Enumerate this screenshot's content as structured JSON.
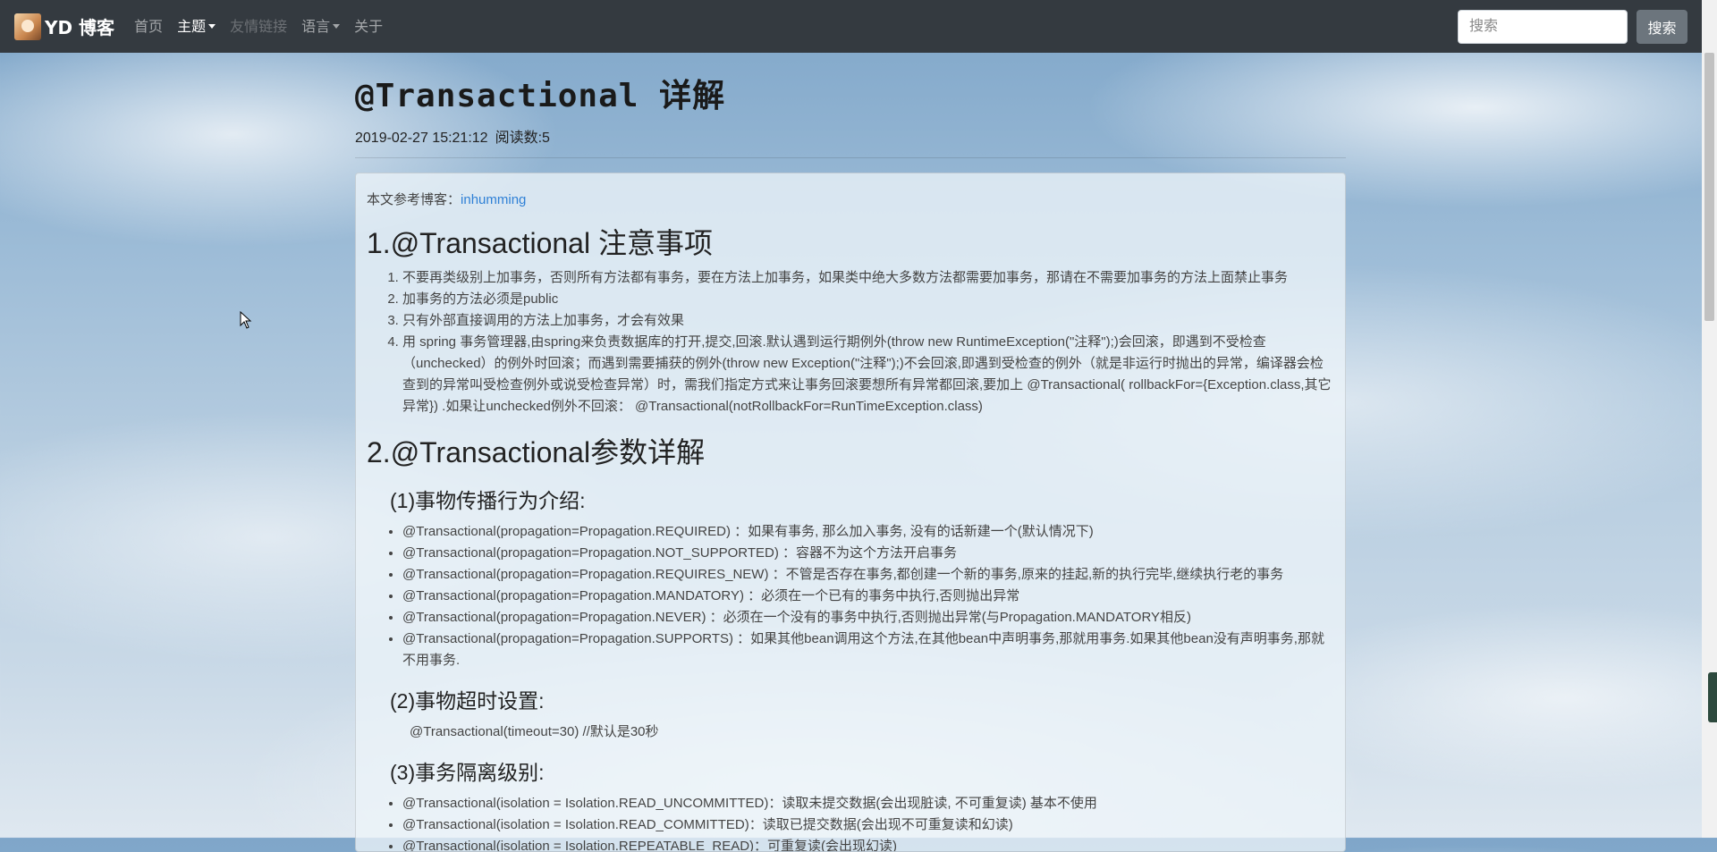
{
  "nav": {
    "brand": "YD 博客",
    "items": [
      {
        "label": "首页"
      },
      {
        "label": "主题"
      },
      {
        "label": "友情链接"
      },
      {
        "label": "语言"
      },
      {
        "label": "关于"
      }
    ],
    "search_placeholder": "搜索",
    "search_button": "搜索"
  },
  "post": {
    "title": "@Transactional 详解",
    "date": "2019-02-27 15:21:12",
    "reads": "阅读数:5"
  },
  "content": {
    "ref_prefix": "本文参考博客：",
    "ref_link": "inhumming",
    "section1": {
      "heading": "1.@Transactional 注意事项",
      "items": [
        "不要再类级别上加事务，否则所有方法都有事务，要在方法上加事务，如果类中绝大多数方法都需要加事务，那请在不需要加事务的方法上面禁止事务",
        "加事务的方法必须是public",
        "只有外部直接调用的方法上加事务，才会有效果",
        "用 spring 事务管理器,由spring来负责数据库的打开,提交,回滚.默认遇到运行期例外(throw new RuntimeException(\"注释\");)会回滚，即遇到不受检查（unchecked）的例外时回滚；而遇到需要捕获的例外(throw new Exception(\"注释\");)不会回滚,即遇到受检查的例外（就是非运行时抛出的异常，编译器会检查到的异常叫受检查例外或说受检查异常）时，需我们指定方式来让事务回滚要想所有异常都回滚,要加上 @Transactional( rollbackFor={Exception.class,其它异常}) .如果让unchecked例外不回滚： @Transactional(notRollbackFor=RunTimeException.class)"
      ]
    },
    "section2": {
      "heading": "2.@Transactional参数详解",
      "sub1": {
        "heading": "(1)事物传播行为介绍:",
        "items": [
          "@Transactional(propagation=Propagation.REQUIRED) ：如果有事务, 那么加入事务, 没有的话新建一个(默认情况下)",
          "@Transactional(propagation=Propagation.NOT_SUPPORTED) ：容器不为这个方法开启事务",
          "@Transactional(propagation=Propagation.REQUIRES_NEW) ：不管是否存在事务,都创建一个新的事务,原来的挂起,新的执行完毕,继续执行老的事务",
          "@Transactional(propagation=Propagation.MANDATORY) ：必须在一个已有的事务中执行,否则抛出异常",
          "@Transactional(propagation=Propagation.NEVER) ：必须在一个没有的事务中执行,否则抛出异常(与Propagation.MANDATORY相反)",
          "@Transactional(propagation=Propagation.SUPPORTS) ：如果其他bean调用这个方法,在其他bean中声明事务,那就用事务.如果其他bean没有声明事务,那就不用事务."
        ]
      },
      "sub2": {
        "heading": "(2)事物超时设置:",
        "text": "@Transactional(timeout=30) //默认是30秒"
      },
      "sub3": {
        "heading": "(3)事务隔离级别:",
        "items": [
          "@Transactional(isolation = Isolation.READ_UNCOMMITTED)：读取未提交数据(会出现脏读, 不可重复读) 基本不使用",
          "@Transactional(isolation = Isolation.READ_COMMITTED)：读取已提交数据(会出现不可重复读和幻读)",
          "@Transactional(isolation = Isolation.REPEATABLE_READ)：可重复读(会出现幻读)"
        ]
      }
    }
  }
}
